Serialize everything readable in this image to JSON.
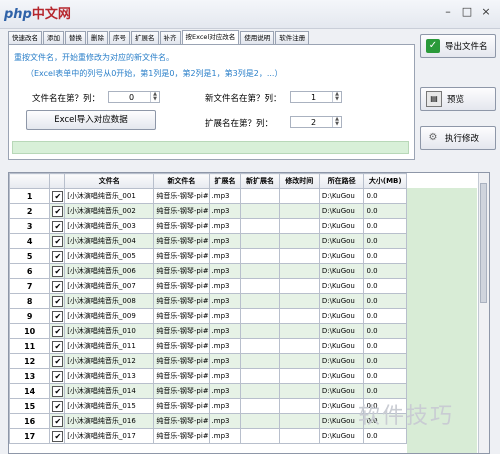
{
  "watermark_top": {
    "prefix": "php",
    "suffix": "中文网"
  },
  "watermark_bottom": "软件技巧",
  "window_controls": {
    "minimize": "–",
    "maximize": "□",
    "close": "×"
  },
  "tabs": [
    "快速改名",
    "添加",
    "替换",
    "删除",
    "序号",
    "扩展名",
    "补齐",
    "按Excel对应改名",
    "使用说明",
    "软件注册"
  ],
  "active_tab": 7,
  "hint": "重按文件名，开始重修改为对应的新文件名。",
  "excel_note": "（Excel表单中的列号从0开始，第1列是0，第2列是1，第3列是2，...）",
  "filename_col_label": "文件名在第？列：",
  "filename_col_value": "0",
  "newname_col_label": "新文件名在第？列：",
  "newname_col_value": "1",
  "ext_col_label": "扩展名在第？列：",
  "ext_col_value": "2",
  "import_button": "Excel导入对应数据",
  "side_buttons": {
    "export": "导出文件名",
    "preview": "预览",
    "execute": "执行修改"
  },
  "table": {
    "headers": [
      "",
      "",
      "文件名",
      "新文件名",
      "扩展名",
      "新扩展名",
      "修改时间",
      "所在路径",
      "大小(MB)"
    ],
    "rows": [
      {
        "n": "1",
        "name": "[小沐演唱纯音乐_001",
        "new": "纯音乐-钢琴-pi#01",
        "ext": ".mp3",
        "path": "D:\\KuGou",
        "size": "0.0"
      },
      {
        "n": "2",
        "name": "[小沐演唱纯音乐_002",
        "new": "纯音乐-钢琴-pi#02",
        "ext": ".mp3",
        "path": "D:\\KuGou",
        "size": "0.0"
      },
      {
        "n": "3",
        "name": "[小沐演唱纯音乐_003",
        "new": "纯音乐-钢琴-pi#03",
        "ext": ".mp3",
        "path": "D:\\KuGou",
        "size": "0.0"
      },
      {
        "n": "4",
        "name": "[小沐演唱纯音乐_004",
        "new": "纯音乐-钢琴-pi#04",
        "ext": ".mp3",
        "path": "D:\\KuGou",
        "size": "0.0"
      },
      {
        "n": "5",
        "name": "[小沐演唱纯音乐_005",
        "new": "纯音乐-钢琴-pi#05",
        "ext": ".mp3",
        "path": "D:\\KuGou",
        "size": "0.0"
      },
      {
        "n": "6",
        "name": "[小沐演唱纯音乐_006",
        "new": "纯音乐-钢琴-pi#06",
        "ext": ".mp3",
        "path": "D:\\KuGou",
        "size": "0.0"
      },
      {
        "n": "7",
        "name": "[小沐演唱纯音乐_007",
        "new": "纯音乐-钢琴-pi#07",
        "ext": ".mp3",
        "path": "D:\\KuGou",
        "size": "0.0"
      },
      {
        "n": "8",
        "name": "[小沐演唱纯音乐_008",
        "new": "纯音乐-钢琴-pi#08",
        "ext": ".mp3",
        "path": "D:\\KuGou",
        "size": "0.0"
      },
      {
        "n": "9",
        "name": "[小沐演唱纯音乐_009",
        "new": "纯音乐-钢琴-pi#09",
        "ext": ".mp3",
        "path": "D:\\KuGou",
        "size": "0.0"
      },
      {
        "n": "10",
        "name": "[小沐演唱纯音乐_010",
        "new": "纯音乐-钢琴-pi#10",
        "ext": ".mp3",
        "path": "D:\\KuGou",
        "size": "0.0"
      },
      {
        "n": "11",
        "name": "[小沐演唱纯音乐_011",
        "new": "纯音乐-钢琴-pi#11",
        "ext": ".mp3",
        "path": "D:\\KuGou",
        "size": "0.0"
      },
      {
        "n": "12",
        "name": "[小沐演唱纯音乐_012",
        "new": "纯音乐-钢琴-pi#12",
        "ext": ".mp3",
        "path": "D:\\KuGou",
        "size": "0.0"
      },
      {
        "n": "13",
        "name": "[小沐演唱纯音乐_013",
        "new": "纯音乐-钢琴-pi#13",
        "ext": ".mp3",
        "path": "D:\\KuGou",
        "size": "0.0"
      },
      {
        "n": "14",
        "name": "[小沐演唱纯音乐_014",
        "new": "纯音乐-钢琴-pi#14",
        "ext": ".mp3",
        "path": "D:\\KuGou",
        "size": "0.0"
      },
      {
        "n": "15",
        "name": "[小沐演唱纯音乐_015",
        "new": "纯音乐-钢琴-pi#15",
        "ext": ".mp3",
        "path": "D:\\KuGou",
        "size": "0.0"
      },
      {
        "n": "16",
        "name": "[小沐演唱纯音乐_016",
        "new": "纯音乐-钢琴-pi#16",
        "ext": ".mp3",
        "path": "D:\\KuGou",
        "size": "0.0"
      },
      {
        "n": "17",
        "name": "[小沐演唱纯音乐_017",
        "new": "纯音乐-钢琴-pi#17",
        "ext": ".mp3",
        "path": "D:\\KuGou",
        "size": "0.0"
      }
    ]
  }
}
